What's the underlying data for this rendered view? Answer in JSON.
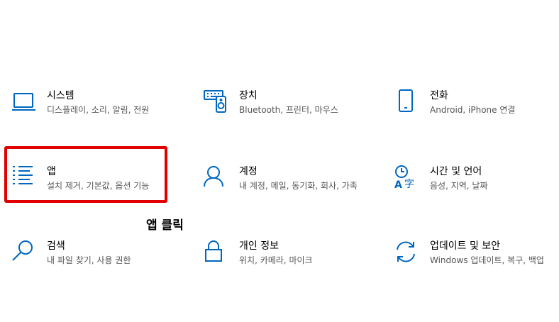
{
  "accent_color": "#0067c0",
  "highlight_color": "#e00000",
  "tiles": [
    {
      "title": "시스템",
      "desc": "디스플레이, 소리, 알림, 전원",
      "icon": "laptop-icon"
    },
    {
      "title": "장치",
      "desc": "Bluetooth, 프린터, 마우스",
      "icon": "devices-icon"
    },
    {
      "title": "전화",
      "desc": "Android, iPhone 연결",
      "icon": "phone-icon"
    },
    {
      "title": "앱",
      "desc": "설치 제거, 기본값, 옵션 기능",
      "icon": "apps-list-icon"
    },
    {
      "title": "계정",
      "desc": "내 계정, 메일, 동기화, 회사, 가족",
      "icon": "person-icon"
    },
    {
      "title": "시간 및 언어",
      "desc": "음성, 지역, 날짜",
      "icon": "time-language-icon"
    },
    {
      "title": "검색",
      "desc": "내 파일 찾기, 사용 권한",
      "icon": "search-icon"
    },
    {
      "title": "개인 정보",
      "desc": "위치, 카메라, 마이크",
      "icon": "lock-icon"
    },
    {
      "title": "업데이트 및 보안",
      "desc": "Windows 업데이트, 복구, 백업",
      "icon": "update-icon"
    }
  ],
  "annotation": "앱 클릭"
}
